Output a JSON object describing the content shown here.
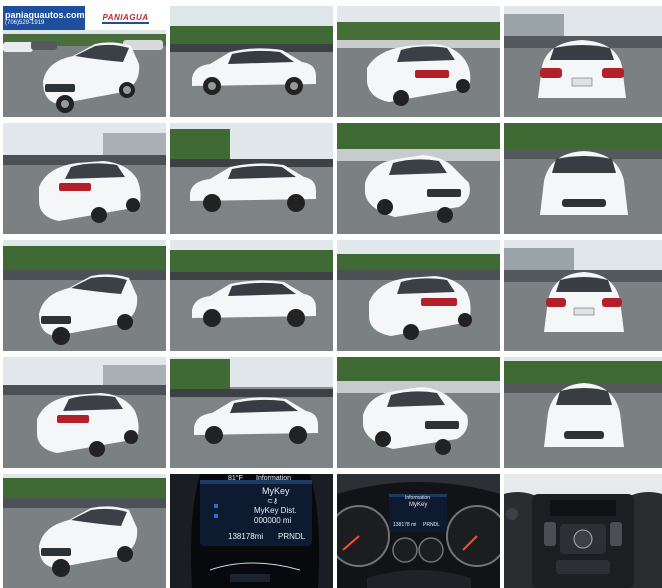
{
  "gallery": {
    "dealer": {
      "url": "paniaguautos.com",
      "phone": "(706)529-1919",
      "logo_text": "PANIAGUA"
    },
    "photos": [
      {
        "view": "front-left-dealer"
      },
      {
        "view": "left-side"
      },
      {
        "view": "rear-left"
      },
      {
        "view": "rear"
      },
      {
        "view": "rear-left-lot"
      },
      {
        "view": "left-side-lot"
      },
      {
        "view": "front-right"
      },
      {
        "view": "front"
      },
      {
        "view": "front-left"
      },
      {
        "view": "left-side-2"
      },
      {
        "view": "rear-left-2"
      },
      {
        "view": "rear-2"
      },
      {
        "view": "rear-left-3"
      },
      {
        "view": "left-side-3"
      },
      {
        "view": "front-right-2"
      },
      {
        "view": "front-2"
      },
      {
        "view": "front-left-3"
      },
      {
        "view": "instrument-cluster"
      },
      {
        "view": "gauges"
      },
      {
        "view": "center-console"
      }
    ],
    "cluster": {
      "header": "Information",
      "title": "MyKey",
      "dist_label": "MyKey Dist.",
      "dist_value": "000000 mi",
      "odometer": "138178mi",
      "gear": "PRNDL",
      "temp": "81°F"
    },
    "gauges_screen": {
      "header": "Information",
      "title": "MyKey",
      "odometer": "138178 mi",
      "gear": "PRNDL"
    }
  },
  "colors": {
    "sky": "#dfe6ea",
    "trees": "#3f6a34",
    "asphalt": "#7b8083",
    "car": "#f4f6f7",
    "taillight": "#b3202a",
    "dealer_blue": "#1e4f9c",
    "dealer_red": "#c1272d"
  }
}
